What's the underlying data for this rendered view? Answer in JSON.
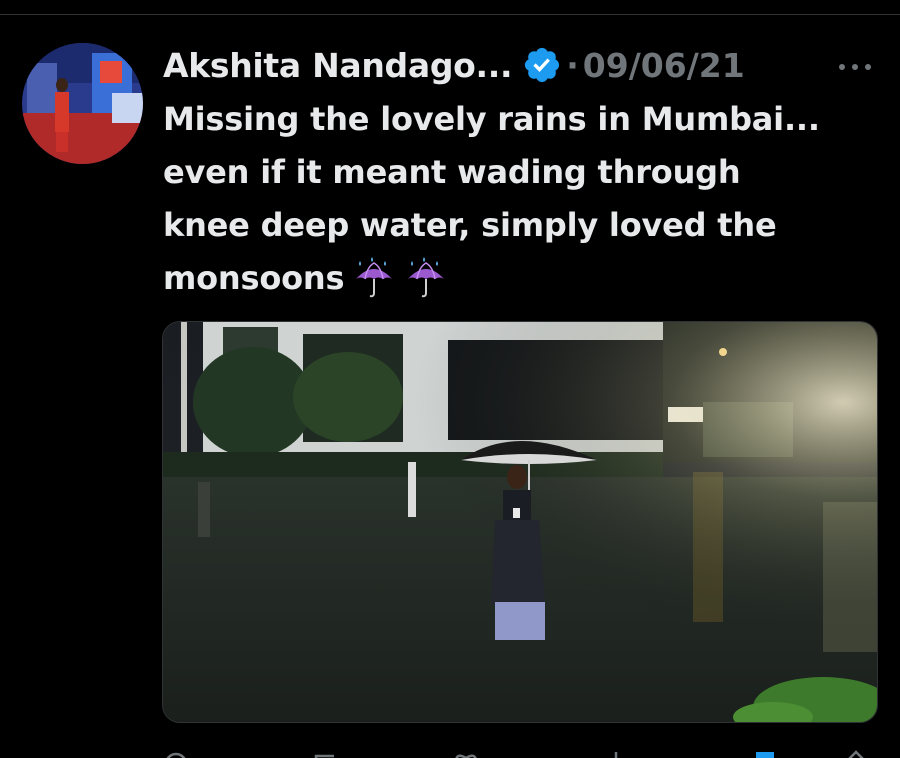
{
  "post": {
    "author_name": "Akshita Nandago...",
    "separator": "·",
    "date": "09/06/21",
    "text": "Missing the lovely rains in Mumbai...\neven if it meant wading through\nknee deep water, simply loved the\nmonsoons"
  },
  "icons": {
    "verified": "verified-badge-icon",
    "more": "more-icon",
    "emoji": "umbrella-with-rain-drops-icon",
    "reply": "reply-icon",
    "repost": "repost-icon",
    "like": "heart-icon",
    "views": "views-icon",
    "bookmark": "bookmark-icon",
    "share": "share-icon"
  },
  "colors": {
    "background": "#000000",
    "text_primary": "#e7e9ea",
    "text_secondary": "#71767b",
    "verified_blue": "#1d9bf0",
    "umbrella_purple": "#9b59d0",
    "divider": "#2f3336"
  }
}
